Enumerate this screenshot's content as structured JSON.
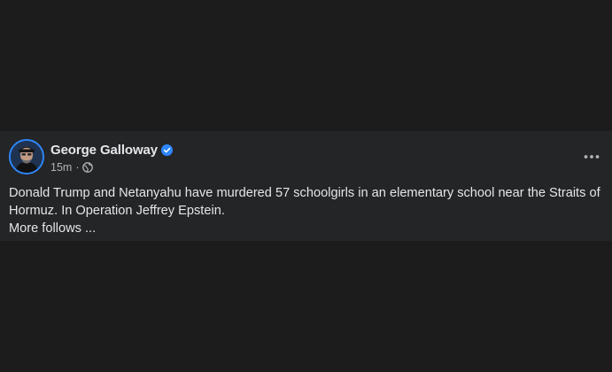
{
  "post": {
    "author_name": "George Galloway",
    "timestamp": "15m",
    "separator": "·",
    "privacy_icon": "globe-icon",
    "verified_icon": "verified-badge-icon",
    "more_icon": "more-options-icon",
    "text_line1": "Donald Trump and Netanyahu have murdered 57 schoolgirls in an elementary school near the Straits of Hormuz. In Operation Jeffrey Epstein.",
    "text_line2": "More follows ..."
  },
  "colors": {
    "page_background": "#1c1c1d",
    "card_background": "#242526",
    "primary_text": "#e4e6eb",
    "secondary_text": "#b0b3b8",
    "verified_blue": "#2d88ff"
  }
}
